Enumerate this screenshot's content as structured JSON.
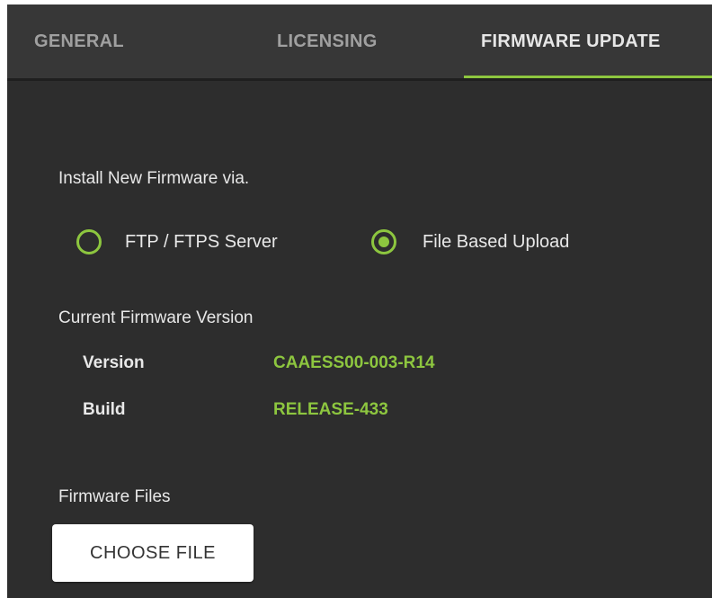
{
  "tabs": {
    "general": "GENERAL",
    "licensing": "LICENSING",
    "firmware_update": "FIRMWARE UPDATE",
    "active": "firmware_update"
  },
  "install": {
    "label": "Install New Firmware via.",
    "options": [
      {
        "label": "FTP / FTPS Server",
        "selected": false
      },
      {
        "label": "File Based Upload",
        "selected": true
      }
    ]
  },
  "current_version": {
    "heading": "Current Firmware Version",
    "version_key": "Version",
    "version_value": "CAAESS00-003-R14",
    "build_key": "Build",
    "build_value": "RELEASE-433"
  },
  "firmware_files": {
    "label": "Firmware Files",
    "choose_button": "CHOOSE FILE"
  },
  "colors": {
    "accent": "#8dc63f",
    "panel_bg": "#2d2d2d",
    "tabbar_bg": "#373737"
  }
}
